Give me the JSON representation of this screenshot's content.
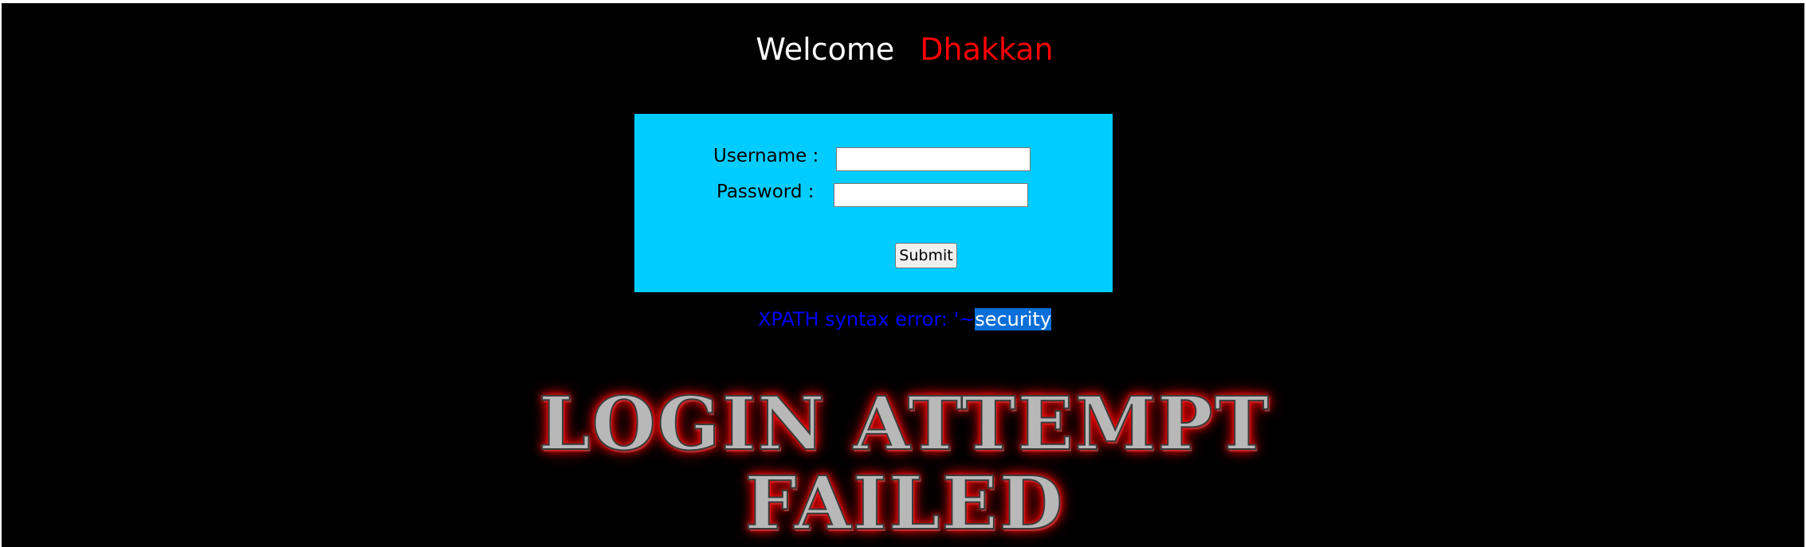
{
  "header": {
    "welcome": "Welcome",
    "name": "Dhakkan"
  },
  "form": {
    "username_label": "Username :",
    "username_value": "",
    "password_label": "Password :",
    "password_value": "",
    "submit_label": "Submit"
  },
  "error": {
    "prefix": "XPATH syntax error: '~",
    "highlight": "security"
  },
  "banner": {
    "line1": "LOGIN ATTEMPT",
    "line2": "FAILED"
  },
  "colors": {
    "background": "#000000",
    "form_background": "#00ccff",
    "name": "#ff0000",
    "error": "#0000ff",
    "selection": "#0a6fd8"
  }
}
